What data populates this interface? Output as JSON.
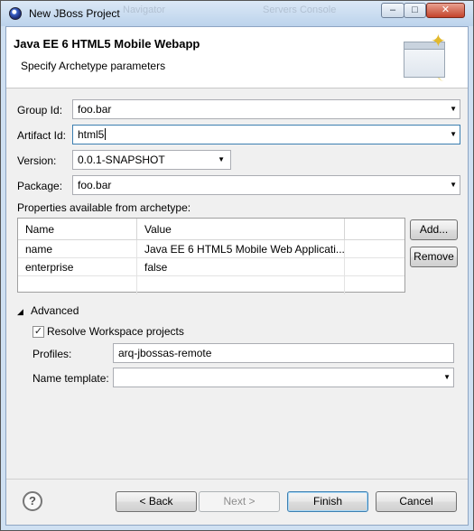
{
  "window": {
    "title": "New JBoss Project",
    "background_titles": [
      "Navigator",
      "Servers Console"
    ]
  },
  "banner": {
    "title": "Java EE 6 HTML5 Mobile Webapp",
    "description": "Specify Archetype parameters"
  },
  "form": {
    "group_id": {
      "label": "Group Id:",
      "value": "foo.bar"
    },
    "artifact_id": {
      "label": "Artifact Id:",
      "value": "html5"
    },
    "version": {
      "label": "Version:",
      "value": "0.0.1-SNAPSHOT"
    },
    "package": {
      "label": "Package:",
      "value": "foo.bar"
    }
  },
  "properties": {
    "label": "Properties available from archetype:",
    "columns": [
      "Name",
      "Value"
    ],
    "rows": [
      {
        "name": "name",
        "value": "Java EE 6 HTML5 Mobile Web Applicati..."
      },
      {
        "name": "enterprise",
        "value": "false"
      }
    ],
    "add_label": "Add...",
    "remove_label": "Remove"
  },
  "advanced": {
    "label": "Advanced",
    "expanded": true,
    "resolve_workspace": {
      "label": "Resolve Workspace projects",
      "checked": true
    },
    "profiles": {
      "label": "Profiles:",
      "value": "arq-jbossas-remote"
    },
    "name_template": {
      "label": "Name template:",
      "value": ""
    }
  },
  "buttons": {
    "back": "< Back",
    "next": "Next >",
    "finish": "Finish",
    "cancel": "Cancel"
  },
  "icons": {
    "app": "eclipse-icon",
    "help": "help-icon",
    "banner": "wizard-window-icon"
  }
}
